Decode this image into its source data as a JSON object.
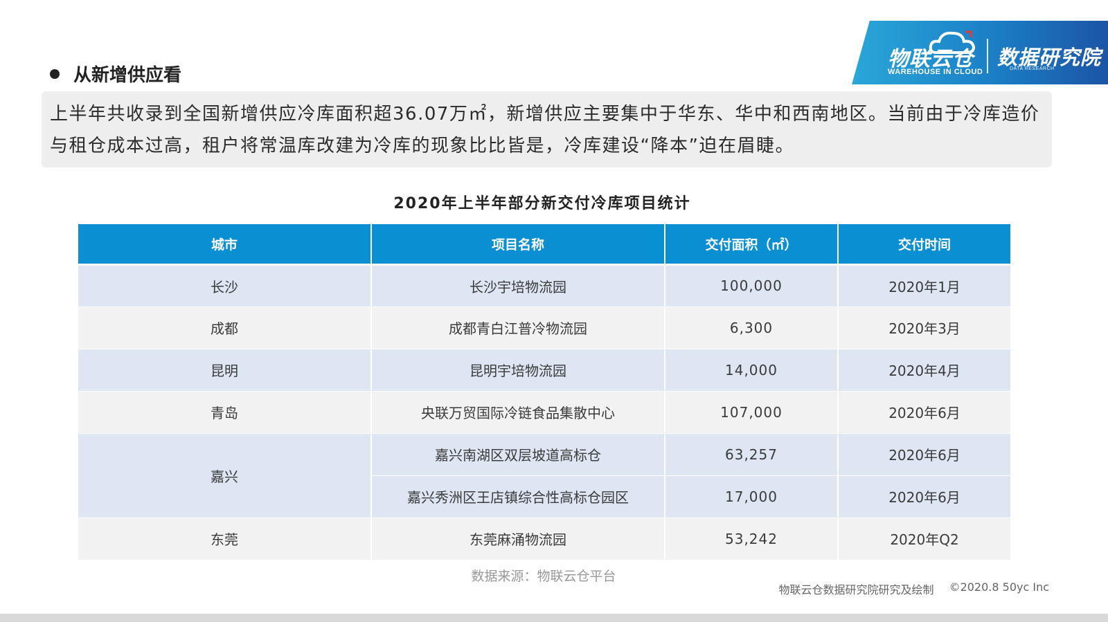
{
  "logo": {
    "brand": "物联云仓",
    "brand_en": "WAREHOUSE IN CLOUD",
    "research": "数据研究院",
    "research_en": "DATA RESEARCH"
  },
  "section": {
    "title": "从新增供应看"
  },
  "summary": {
    "text": "上半年共收录到全国新增供应冷库面积超36.07万㎡，新增供应主要集中于华东、华中和西南地区。当前由于冷库造价与租仓成本过高，租户将常温库改建为冷库的现象比比皆是，冷库建设“降本”迫在眉睫。"
  },
  "table": {
    "title": "2020年上半年部分新交付冷库项目统计",
    "headers": [
      "城市",
      "项目名称",
      "交付面积（㎡）",
      "交付时间"
    ],
    "rows": [
      {
        "city": "长沙",
        "project": "长沙宇培物流园",
        "area": "100,000",
        "date": "2020年1月"
      },
      {
        "city": "成都",
        "project": "成都青白江普冷物流园",
        "area": "6,300",
        "date": "2020年3月"
      },
      {
        "city": "昆明",
        "project": "昆明宇培物流园",
        "area": "14,000",
        "date": "2020年4月"
      },
      {
        "city": "青岛",
        "project": "央联万贸国际冷链食品集散中心",
        "area": "107,000",
        "date": "2020年6月"
      },
      {
        "city": "嘉兴",
        "project": "嘉兴南湖区双层坡道高标仓",
        "area": "63,257",
        "date": "2020年6月"
      },
      {
        "city": "",
        "project": "嘉兴秀洲区王店镇综合性高标仓园区",
        "area": "17,000",
        "date": "2020年6月"
      },
      {
        "city": "东莞",
        "project": "东莞麻涌物流园",
        "area": "53,242",
        "date": "2020年Q2"
      }
    ]
  },
  "footer": {
    "source": "数据来源：物联云仓平台",
    "credit_org": "物联云仓数据研究院研究及绘制",
    "copyright": "©2020.8 50yc Inc"
  },
  "colors": {
    "header_blue": "#0b8fd3",
    "row_light_blue": "#dde6f2",
    "row_light_gray": "#f2f2f2"
  }
}
